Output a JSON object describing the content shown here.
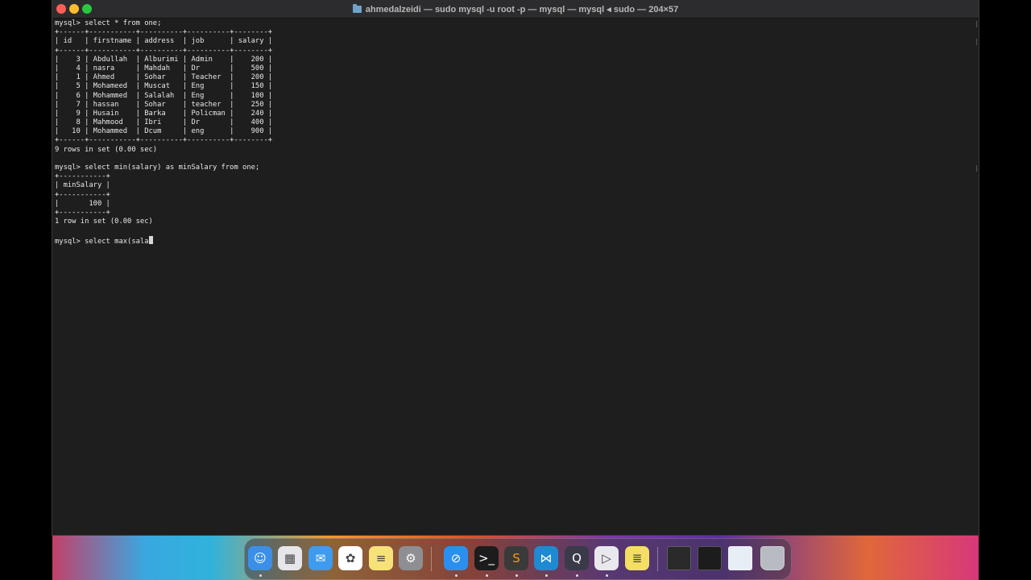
{
  "window": {
    "title": "ahmedalzeidi — sudo mysql -u root -p — mysql — mysql ◂ sudo — 204×57",
    "terminal_lines": [
      "mysql> select * from one;",
      "+------+-----------+----------+----------+--------+",
      "| id   | firstname | address  | job      | salary |",
      "+------+-----------+----------+----------+--------+",
      "|    3 | Abdullah  | Alburimi | Admin    |    200 |",
      "|    4 | nasra     | Mahdah   | Dr       |    500 |",
      "|    1 | Ahmed     | Sohar    | Teacher  |    200 |",
      "|    5 | Mohameed  | Muscat   | Eng      |    150 |",
      "|    6 | Mohammed  | Salalah  | Eng      |    100 |",
      "|    7 | hassan    | Sohar    | teacher  |    250 |",
      "|    9 | Husain    | Barka    | Policman |    240 |",
      "|    8 | Mahmood   | Ibri     | Dr       |    400 |",
      "|   10 | Mohammed  | Dcum     | eng      |    900 |",
      "+------+-----------+----------+----------+--------+",
      "9 rows in set (0.00 sec)",
      "",
      "mysql> select min(salary) as minSalary from one;",
      "+-----------+",
      "| minSalary |",
      "+-----------+",
      "|       100 |",
      "+-----------+",
      "1 row in set (0.00 sec)",
      "",
      "mysql> select max(sala"
    ]
  },
  "dock": {
    "apps": [
      {
        "name": "Finder",
        "icon": "finder-icon",
        "glyph": "☺",
        "bg": "#3b8fe8",
        "running": true
      },
      {
        "name": "Launchpad",
        "icon": "launchpad-icon",
        "glyph": "▦",
        "bg": "#e6e6ea",
        "running": false
      },
      {
        "name": "Mail",
        "icon": "mail-icon",
        "glyph": "✉",
        "bg": "#3d9bf0",
        "running": false
      },
      {
        "name": "Photos",
        "icon": "photos-icon",
        "glyph": "✿",
        "bg": "#ffffff",
        "running": false
      },
      {
        "name": "Notes",
        "icon": "notes-icon",
        "glyph": "≡",
        "bg": "#f7e27a",
        "running": false
      },
      {
        "name": "System Settings",
        "icon": "settings-icon",
        "glyph": "⚙",
        "bg": "#8e8e93",
        "running": false
      },
      {
        "name": "Safari",
        "icon": "safari-icon",
        "glyph": "⊘",
        "bg": "#2b8ff0",
        "running": true
      },
      {
        "name": "Terminal",
        "icon": "terminal-icon",
        "glyph": ">_",
        "bg": "#1c1c1c",
        "running": true
      },
      {
        "name": "Sublime Text",
        "icon": "sublime-icon",
        "glyph": "S",
        "bg": "#3a3a3a",
        "running": true
      },
      {
        "name": "Visual Studio Code",
        "icon": "vscode-icon",
        "glyph": "⋈",
        "bg": "#1f8ad2",
        "running": true
      },
      {
        "name": "QuickTime Player",
        "icon": "quicktime-icon",
        "glyph": "Q",
        "bg": "#3a3a4a",
        "running": true
      },
      {
        "name": "Script Editor",
        "icon": "editor-icon",
        "glyph": "▷",
        "bg": "#e8e8ee",
        "running": true
      },
      {
        "name": "Stickies",
        "icon": "stickies-icon",
        "glyph": "≣",
        "bg": "#f5df62",
        "running": false
      }
    ],
    "recents": [
      {
        "name": "Window thumbnail 1",
        "icon": "window-thumbnail-icon",
        "bg": "#2a2a2a"
      },
      {
        "name": "Window thumbnail 2",
        "icon": "window-thumbnail-icon",
        "bg": "#1c1c1c"
      },
      {
        "name": "Window thumbnail 3",
        "icon": "window-thumbnail-icon",
        "bg": "#e8eef5"
      },
      {
        "name": "Trash",
        "icon": "trash-icon",
        "bg": "#b8bcc2"
      }
    ]
  }
}
